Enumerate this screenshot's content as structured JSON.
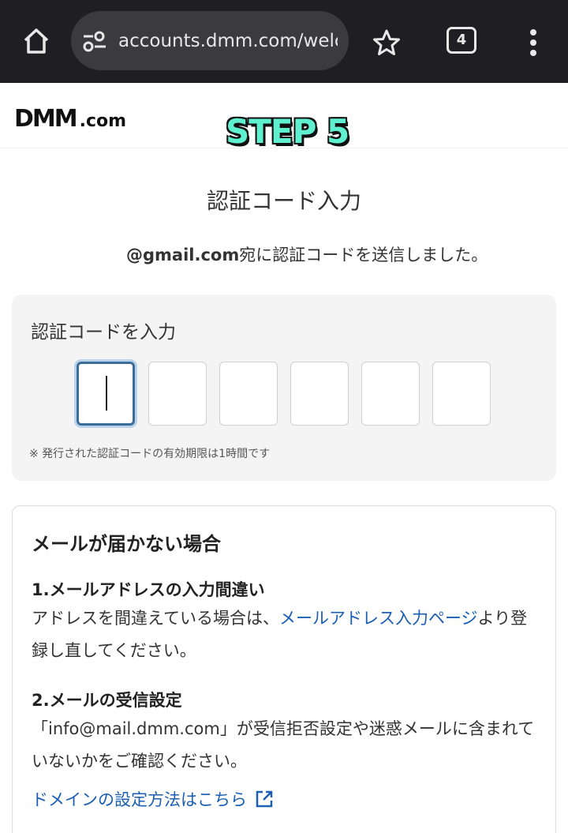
{
  "browser": {
    "url": "accounts.dmm.com/welcome",
    "tab_count": "4",
    "icons": {
      "home": "home-icon",
      "site_settings": "tune-icon",
      "bookmark": "star-icon",
      "tabs": "tabs-icon",
      "menu": "more-vert-icon"
    }
  },
  "header": {
    "logo_main": "DMM",
    "logo_sub": ".com",
    "overlay_text": "STEP 5"
  },
  "main": {
    "title": "認証コード入力",
    "sent_email": "@gmail.com",
    "sent_suffix": "宛に認証コードを送信しました。"
  },
  "code_input": {
    "label": "認証コードを入力",
    "digits": [
      "",
      "",
      "",
      "",
      "",
      ""
    ],
    "note": "※ 発行された認証コードの有効期限は1時間です"
  },
  "help": {
    "heading": "メールが届かない場合",
    "section1_title": "1.メールアドレスの入力間違い",
    "section1_text_before": "アドレスを間違えている場合は、",
    "section1_link": "メールアドレス入力ページ",
    "section1_text_after": "より登録し直してください。",
    "section2_title": "2.メールの受信設定",
    "section2_text": "「info@mail.dmm.com」が受信拒否設定や迷惑メールに含まれていないかをご確認ください。",
    "domain_link": "ドメインの設定方法はこちら"
  },
  "colors": {
    "browser_bar": "#1f1f23",
    "link": "#1a5fb4",
    "active_border": "#3c6d96",
    "step_text": "#5ff0d0"
  }
}
